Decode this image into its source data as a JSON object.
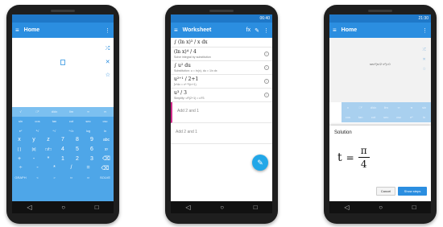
{
  "phone1": {
    "time": "",
    "title": "Home",
    "side_icons": [
      "shuffle-icon",
      "close-icon",
      "star-icon"
    ],
    "keypad": {
      "row1": [
        "√",
        "□²",
        "d/dx",
        "lim",
        "∞",
        "π"
      ],
      "row2": [
        "sin",
        "cos",
        "tan",
        "cot",
        "sec",
        "csc"
      ],
      "row3": [
        "eˣ",
        "²√",
        "ⁿ√",
        "ⁿ√x",
        "log",
        "ln"
      ],
      "row4": [
        "x",
        "y",
        "z",
        "7",
        "8",
        "9",
        "abc"
      ],
      "row5": [
        "( )",
        "|x|",
        "□/□",
        "4",
        "5",
        "6",
        "xʸ"
      ],
      "row6": [
        "+",
        "-",
        "*",
        "1",
        "2",
        "3",
        "⌫"
      ],
      "row7": [
        "÷",
        "-",
        "*",
        "/",
        "=",
        "⌫"
      ],
      "row8": [
        "GRAPH",
        "<",
        ">",
        "⇦",
        "⇨",
        "SOLVE"
      ]
    }
  },
  "phone2": {
    "time": "06:40",
    "title": "Worksheet",
    "items": [
      {
        "math": "∫ (ln x)³ / x dx",
        "note": ""
      },
      {
        "math": "(ln x)⁴ / 4",
        "note": "Solve integral by substitution"
      },
      {
        "math": "∫ u² du",
        "note": "Substitution: u = ln(x), du = 1/x dx"
      },
      {
        "math": "u²⁺¹ / 2+1",
        "note": "∫xⁿdx = xⁿ⁺¹/(n+1)"
      },
      {
        "math": "u³ / 3",
        "note": "Simplify: u³/(2+1) = u³/3"
      }
    ],
    "input1": "Add 2 and 1",
    "input2": "Add 2 and 1"
  },
  "phone3": {
    "time": "21:30",
    "title": "Home",
    "bg_expr": "sec²(π/2·x²)=0",
    "bg_keys": [
      "x",
      "□²",
      "d/dx",
      "lim",
      "∞",
      "π",
      "sin",
      "cos",
      "tan",
      "cot",
      "sec",
      "csc",
      "eˣ",
      "ln"
    ],
    "dialog": {
      "title": "Solution",
      "var": "t",
      "eq": "=",
      "num": "π",
      "den": "4",
      "cancel": "Cancel",
      "show_steps": "Show steps"
    }
  },
  "nav": {
    "back": "◁",
    "home": "○",
    "recent": "□"
  }
}
